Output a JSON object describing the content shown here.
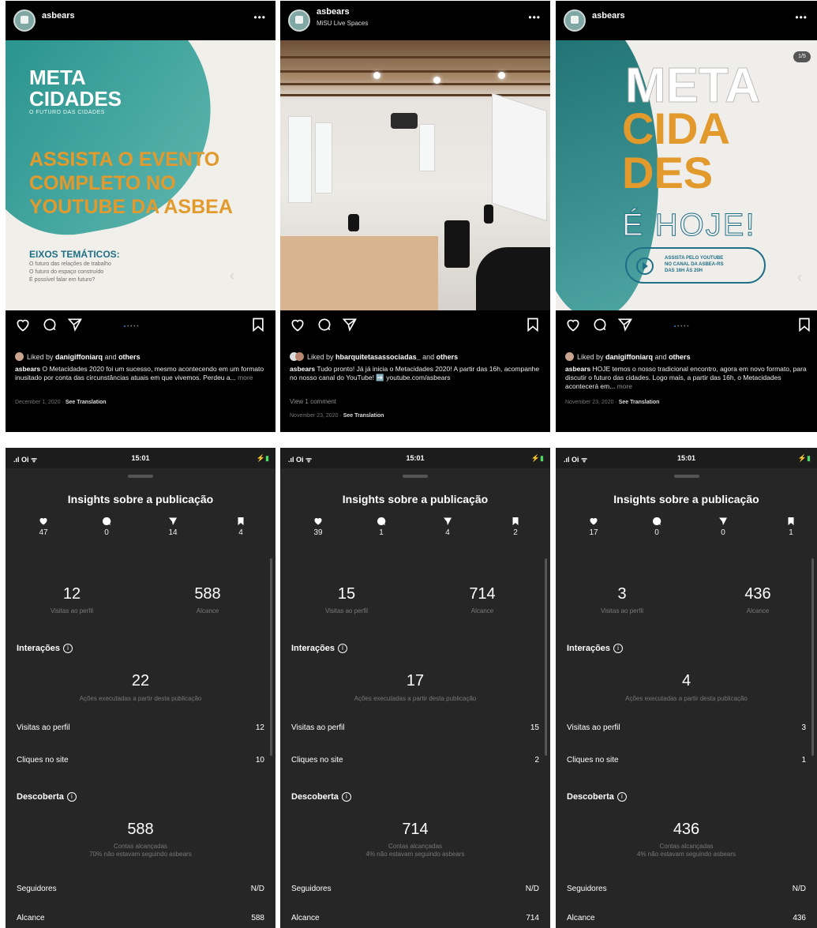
{
  "posts": [
    {
      "username": "asbears",
      "location": "",
      "image": {
        "title_line1": "META",
        "title_line2": "CIDADES",
        "subtitle": "O FUTURO DAS CIDADES",
        "headline_line1": "ASSISTA O EVENTO",
        "headline_line2": "COMPLETO NO",
        "headline_line3": "YOUTUBE DA ASBEA",
        "section_title": "EIXOS TEMÁTICOS:",
        "items": [
          "O futuro das relações de trabalho",
          "O futuro do espaço construído",
          "É possível falar em futuro?"
        ]
      },
      "liked_by_user": "danigiffoniarq",
      "liked_text_mid": " and ",
      "liked_others": "others",
      "liked_prefix": "Liked by ",
      "caption_user": "asbears",
      "caption": " O Metacidades 2020 foi um sucesso, mesmo acontecendo em um formato inusitado por conta das circunstâncias atuais em que vivemos. Perdeu a... ",
      "more": "more",
      "view_comments": "",
      "date": "December 1, 2020",
      "see_translation": "See Translation"
    },
    {
      "username": "asbears",
      "location": "MiSU Live Spaces",
      "liked_by_user": "hbarquitetasassociadas_",
      "liked_text_mid": " and ",
      "liked_others": "others",
      "liked_prefix": "Liked by ",
      "caption_user": "asbears",
      "caption": " Tudo pronto! Já já inicia o Metacidades 2020! A partir das 16h, acompanhe no nosso canal do YouTube! ➡️ youtube.com/asbears",
      "more": "",
      "view_comments": "View 1 comment",
      "date": "November 23, 2020",
      "see_translation": "See Translation"
    },
    {
      "username": "asbears",
      "location": "",
      "image": {
        "title_line1": "META",
        "title_line2": "CIDA",
        "title_line3": "DES",
        "title_line4": "É HOJE!",
        "pill_text_1": "ASSISTA PELO YOUTUBE",
        "pill_text_2": "NO CANAL DA ASBEA-RS",
        "pill_text_3": "DAS 16H ÀS 20H",
        "badge": "1/5"
      },
      "liked_by_user": "danigiffoniarq",
      "liked_text_mid": " and ",
      "liked_others": "others",
      "liked_prefix": "Liked by ",
      "caption_user": "asbears",
      "caption": " HOJE temos o nosso tradicional encontro, agora em novo formato, para discutir o futuro das cidades. Logo mais, a partir das 16h, o Metacidades acontecerá em... ",
      "more": "more",
      "view_comments": "",
      "date": "November 23, 2020",
      "see_translation": "See Translation"
    }
  ],
  "insights": [
    {
      "status_time": "15:01",
      "title": "Insights sobre a publicação",
      "stats": [
        "47",
        "0",
        "14",
        "4"
      ],
      "profile_visits": "12",
      "profile_visits_label": "Visitas ao perfil",
      "reach": "588",
      "reach_label": "Alcance",
      "interactions_title": "Interações",
      "interactions_value": "22",
      "interactions_label": "Ações executadas a partir desta publicação",
      "row_profile_visits_label": "Visitas ao perfil",
      "row_profile_visits_value": "12",
      "row_site_clicks_label": "Cliques no site",
      "row_site_clicks_value": "10",
      "discovery_title": "Descoberta",
      "accounts_reached": "588",
      "accounts_reached_label": "Contas alcançadas",
      "not_following_label": "70% não estavam seguindo asbears",
      "followers_label": "Seguidores",
      "followers_value": "N/D",
      "reach_row_label": "Alcance",
      "reach_row_value": "588"
    },
    {
      "status_time": "15:01",
      "title": "Insights sobre a publicação",
      "stats": [
        "39",
        "1",
        "4",
        "2"
      ],
      "profile_visits": "15",
      "profile_visits_label": "Visitas ao perfil",
      "reach": "714",
      "reach_label": "Alcance",
      "interactions_title": "Interações",
      "interactions_value": "17",
      "interactions_label": "Ações executadas a partir desta publicação",
      "row_profile_visits_label": "Visitas ao perfil",
      "row_profile_visits_value": "15",
      "row_site_clicks_label": "Cliques no site",
      "row_site_clicks_value": "2",
      "discovery_title": "Descoberta",
      "accounts_reached": "714",
      "accounts_reached_label": "Contas alcançadas",
      "not_following_label": "4% não estavam seguindo asbears",
      "followers_label": "Seguidores",
      "followers_value": "N/D",
      "reach_row_label": "Alcance",
      "reach_row_value": "714"
    },
    {
      "status_time": "15:01",
      "title": "Insights sobre a publicação",
      "stats": [
        "17",
        "0",
        "0",
        "1"
      ],
      "profile_visits": "3",
      "profile_visits_label": "Visitas ao perfil",
      "reach": "436",
      "reach_label": "Alcance",
      "interactions_title": "Interações",
      "interactions_value": "4",
      "interactions_label": "Ações executadas a partir desta publicação",
      "row_profile_visits_label": "Visitas ao perfil",
      "row_profile_visits_value": "3",
      "row_site_clicks_label": "Cliques no site",
      "row_site_clicks_value": "1",
      "discovery_title": "Descoberta",
      "accounts_reached": "436",
      "accounts_reached_label": "Contas alcançadas",
      "not_following_label": "4% não estavam seguindo asbears",
      "followers_label": "Seguidores",
      "followers_value": "N/D",
      "reach_row_label": "Alcance",
      "reach_row_value": "436"
    }
  ],
  "colors": {
    "accent_orange": "#e29a2d",
    "teal": "#1f8d87",
    "link_blue": "#3897f0",
    "panel_bg": "#262626"
  },
  "icons": [
    "heart-icon",
    "comment-icon",
    "share-icon",
    "bookmark-icon",
    "more-icon",
    "info-icon"
  ]
}
